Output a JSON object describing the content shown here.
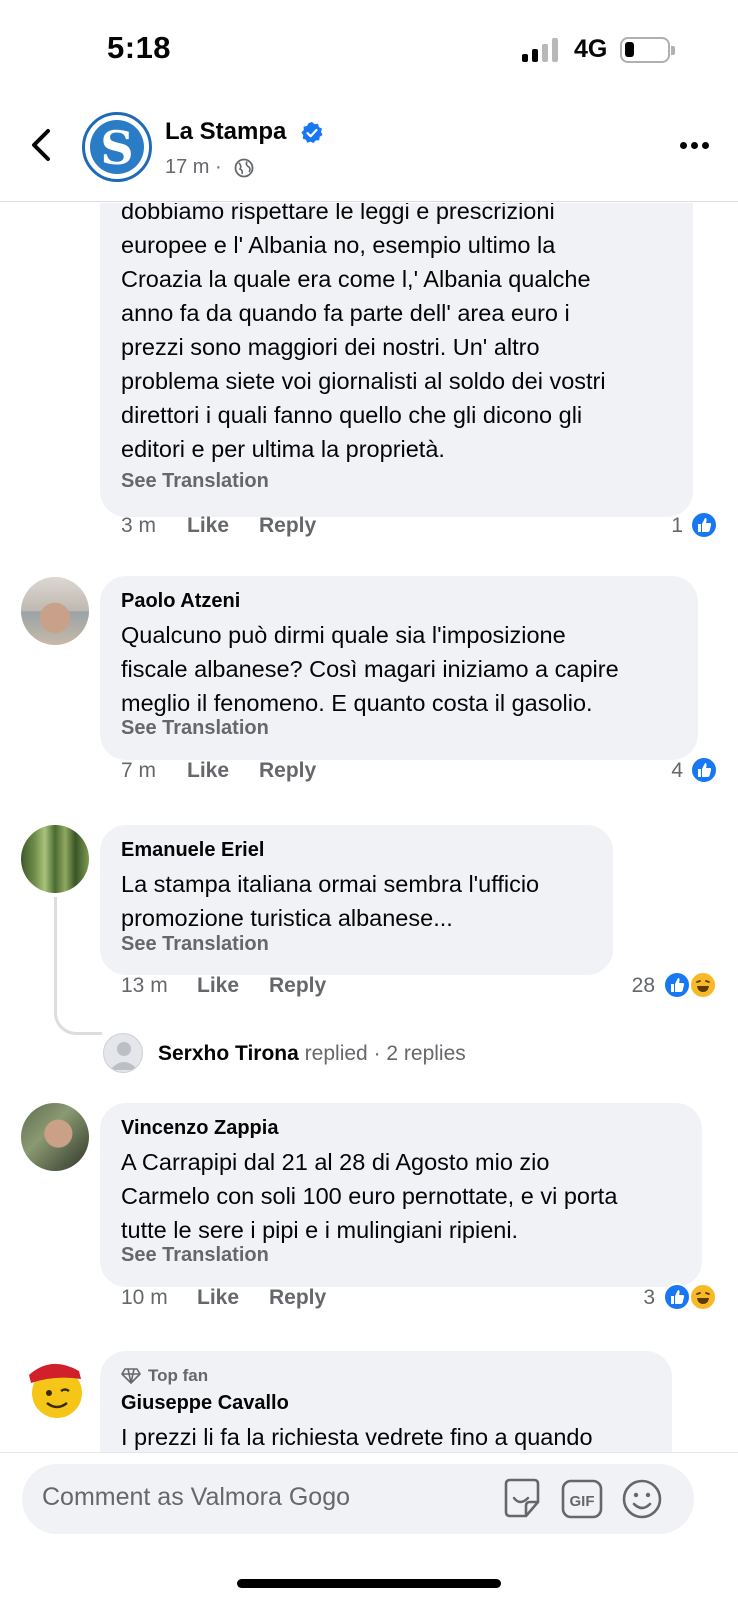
{
  "status_bar": {
    "time": "5:18",
    "network": "4G"
  },
  "header": {
    "page_name": "La Stampa",
    "post_age": "17 m",
    "separator": "·"
  },
  "comments": [
    {
      "author": "",
      "text": "dobbiamo rispettare le leggi e prescrizioni\neuropee e l' Albania no, esempio ultimo la\nCroazia la quale era come l,' Albania qualche\nanno fa da quando fa parte dell' area euro i\nprezzi sono maggiori dei nostri. Un' altro\nproblema siete voi giornalisti al soldo dei vostri\ndirettori i quali fanno quello che gli dicono gli\neditori e per ultima la proprietà.",
      "see_translation": "See Translation",
      "time": "3 m",
      "like": "Like",
      "reply": "Reply",
      "reactions": "1"
    },
    {
      "author": "Paolo Atzeni",
      "text": "Qualcuno può dirmi quale sia l'imposizione\nfiscale albanese?  Così magari iniziamo a capire\nmeglio il fenomeno.  E quanto costa il gasolio.",
      "see_translation": "See Translation",
      "time": "7 m",
      "like": "Like",
      "reply": "Reply",
      "reactions": "4"
    },
    {
      "author": "Emanuele Eriel",
      "text": "La stampa italiana ormai sembra l'ufficio\npromozione turistica albanese...",
      "see_translation": "See Translation",
      "time": "13 m",
      "like": "Like",
      "reply": "Reply",
      "reactions": "28",
      "replies": {
        "name": "Serxho Tirona",
        "action": "replied",
        "count": "· 2 replies"
      }
    },
    {
      "author": "Vincenzo Zappia",
      "text": "A Carrapipi dal 21 al 28 di Agosto mio zio\nCarmelo con soli 100 euro pernottate, e vi porta\ntutte le sere i pipi e i mulingiani ripieni.",
      "see_translation": "See Translation",
      "time": "10 m",
      "like": "Like",
      "reply": "Reply",
      "reactions": "3"
    },
    {
      "badge": "Top fan",
      "author": "Giuseppe Cavallo",
      "text": "I prezzi li fa la richiesta vedrete fino a quando"
    }
  ],
  "composer": {
    "placeholder": "Comment as Valmora Gogo"
  },
  "icons": {
    "back": "chevron-left-icon",
    "verified": "verified-badge-icon",
    "privacy": "globe-icon",
    "more": "more-dots-icon",
    "like": "like-reaction-icon",
    "haha": "haha-reaction-icon",
    "sticker": "sticker-icon",
    "gif": "gif-icon",
    "emoji": "emoji-icon"
  },
  "colors": {
    "accent": "#1877f2",
    "bubble": "#f0f2f5",
    "secondary_text": "#65676b",
    "haha": "#f7b928"
  }
}
